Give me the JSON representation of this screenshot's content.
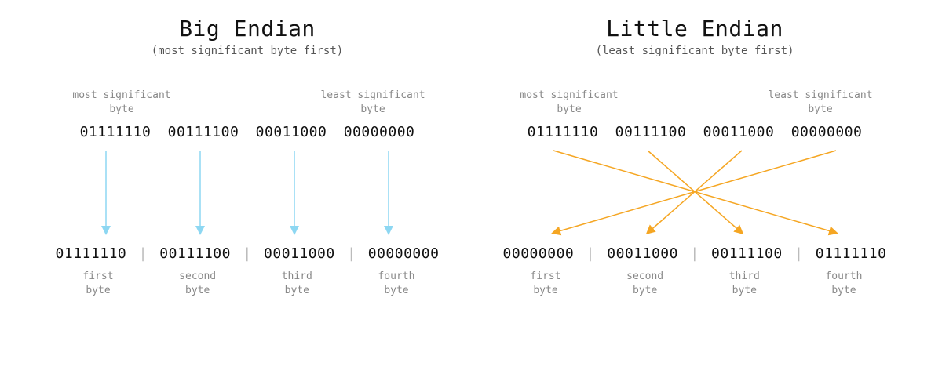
{
  "big": {
    "title": "Big Endian",
    "subtitle": "(most significant byte first)",
    "annot_left_l1": "most significant",
    "annot_left_l2": "byte",
    "annot_right_l1": "least significant",
    "annot_right_l2": "byte",
    "src": "01111110 00111100 00011000 00000000",
    "dst": [
      "01111110",
      "00111100",
      "00011000",
      "00000000"
    ],
    "ord": [
      {
        "l1": "first",
        "l2": "byte"
      },
      {
        "l1": "second",
        "l2": "byte"
      },
      {
        "l1": "third",
        "l2": "byte"
      },
      {
        "l1": "fourth",
        "l2": "byte"
      }
    ],
    "arrow_color": "#8dd7f2"
  },
  "little": {
    "title": "Little Endian",
    "subtitle": "(least significant byte first)",
    "annot_left_l1": "most significant",
    "annot_left_l2": "byte",
    "annot_right_l1": "least significant",
    "annot_right_l2": "byte",
    "src": "01111110 00111100 00011000 00000000",
    "dst": [
      "00000000",
      "00011000",
      "00111100",
      "01111110"
    ],
    "ord": [
      {
        "l1": "first",
        "l2": "byte"
      },
      {
        "l1": "second",
        "l2": "byte"
      },
      {
        "l1": "third",
        "l2": "byte"
      },
      {
        "l1": "fourth",
        "l2": "byte"
      }
    ],
    "arrow_color": "#f5a623"
  },
  "sep": "|"
}
